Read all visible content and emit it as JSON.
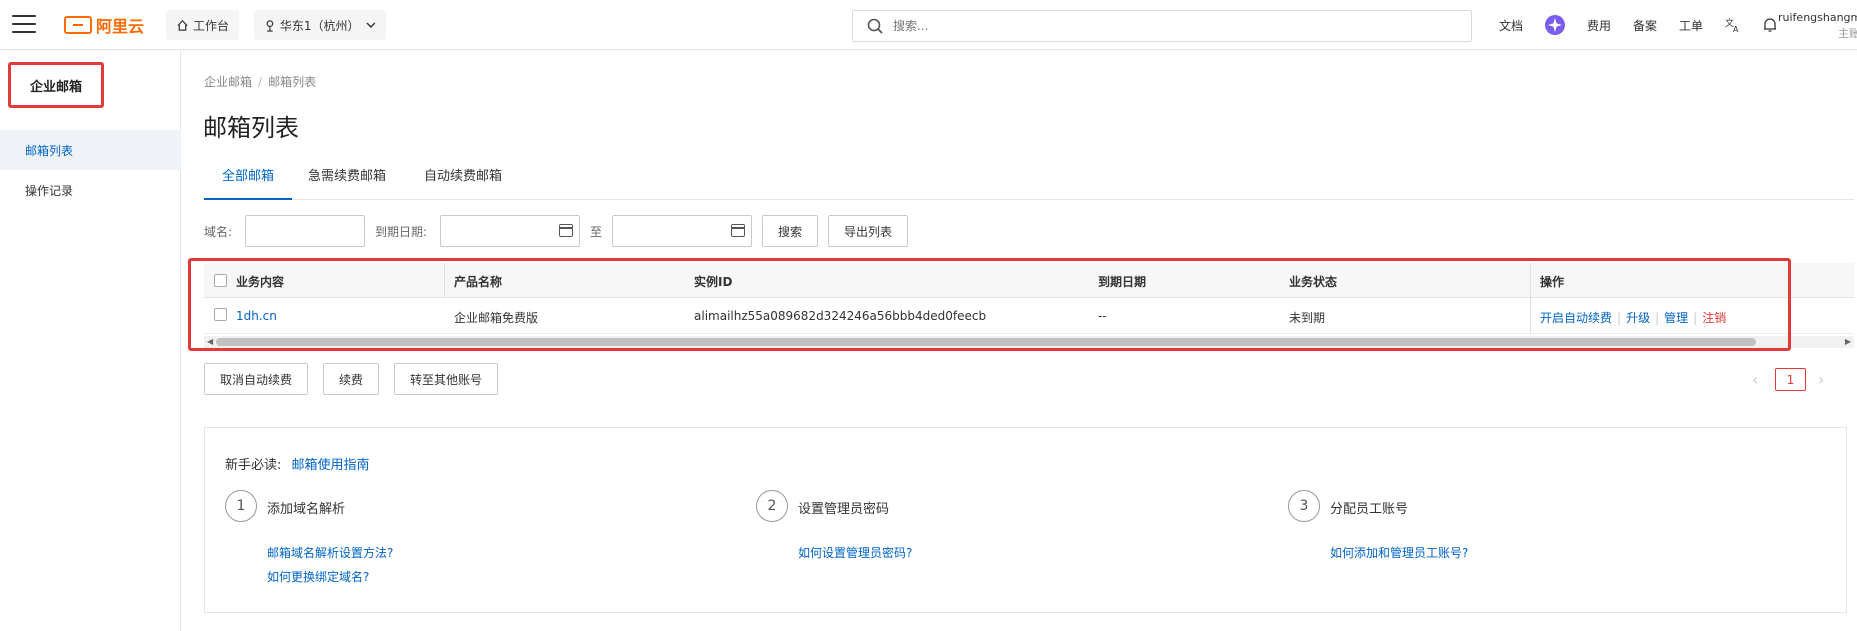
{
  "topbar": {
    "logo_text": "阿里云",
    "workbench_label": "工作台",
    "region_label": "华东1（杭州）",
    "search_placeholder": "搜索...",
    "nav": [
      "文档",
      "费用",
      "备案",
      "工单"
    ],
    "user_name": "ruifengshangm",
    "user_role": "主账"
  },
  "sidebar": {
    "title": "企业邮箱",
    "items": [
      {
        "label": "邮箱列表",
        "active": true
      },
      {
        "label": "操作记录",
        "active": false
      }
    ]
  },
  "breadcrumb": [
    "企业邮箱",
    "邮箱列表"
  ],
  "page_title": "邮箱列表",
  "tabs": [
    {
      "label": "全部邮箱",
      "active": true
    },
    {
      "label": "急需续费邮箱",
      "active": false
    },
    {
      "label": "自动续费邮箱",
      "active": false
    }
  ],
  "filters": {
    "domain_label": "域名:",
    "domain_value": "",
    "expiry_label": "到期日期:",
    "to_label": "至",
    "search_button": "搜索",
    "export_button": "导出列表"
  },
  "table": {
    "headers": [
      "业务内容",
      "产品名称",
      "实例ID",
      "到期日期",
      "业务状态",
      "操作"
    ],
    "rows": [
      {
        "domain": "1dh.cn",
        "product": "企业邮箱免费版",
        "instance_id": "alimailhz55a089682d324246a56bbb4ded0feecb",
        "expiry": "--",
        "status": "未到期",
        "actions": [
          "开启自动续费",
          "升级",
          "管理",
          "注销"
        ]
      }
    ]
  },
  "bulk_actions": [
    "取消自动续费",
    "续费",
    "转至其他账号"
  ],
  "pagination": {
    "current": "1"
  },
  "guide": {
    "prefix": "新手必读:",
    "link": "邮箱使用指南",
    "steps": [
      {
        "num": "1",
        "title": "添加域名解析",
        "links": [
          "邮箱域名解析设置方法?",
          "如何更换绑定域名?"
        ]
      },
      {
        "num": "2",
        "title": "设置管理员密码",
        "links": [
          "如何设置管理员密码?"
        ]
      },
      {
        "num": "3",
        "title": "分配员工账号",
        "links": [
          "如何添加和管理员工账号?"
        ]
      }
    ]
  },
  "colors": {
    "accent": "#0064c8",
    "brand": "#ff6a00",
    "highlight": "#e03a3a"
  }
}
